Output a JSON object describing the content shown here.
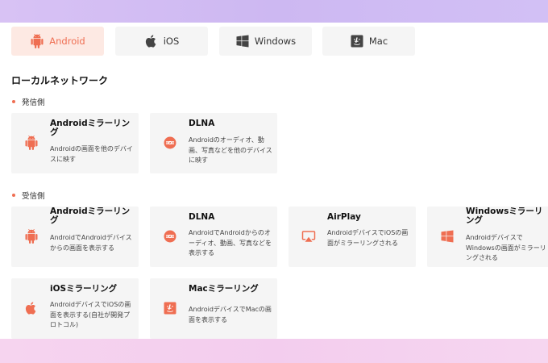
{
  "tabs": [
    {
      "label": "Android",
      "icon": "android-icon",
      "active": true
    },
    {
      "label": "iOS",
      "icon": "apple-icon",
      "active": false
    },
    {
      "label": "Windows",
      "icon": "windows-icon",
      "active": false
    },
    {
      "label": "Mac",
      "icon": "mac-icon",
      "active": false
    }
  ],
  "section_title": "ローカルネットワーク",
  "sender": {
    "label": "発信側",
    "cards": [
      {
        "title": "Androidミラーリング",
        "desc": "Androidの画面を他のデバイスに映す",
        "icon": "android-icon"
      },
      {
        "title": "DLNA",
        "desc": "Androidのオーディオ、動画、写真などを他のデバイスに映す",
        "icon": "dlna-icon"
      }
    ]
  },
  "receiver": {
    "label": "受信側",
    "cards": [
      {
        "title": "Androidミラーリング",
        "desc": "AndroidでAndroidデバイスからの画面を表示する",
        "icon": "android-icon"
      },
      {
        "title": "DLNA",
        "desc": "AndroidでAndroidからのオーディオ、動画、写真などを表示する",
        "icon": "dlna-icon"
      },
      {
        "title": "AirPlay",
        "desc": "AndroidデバイスでiOSの画面がミラーリングされる",
        "icon": "airplay-icon"
      },
      {
        "title": "Windowsミラーリング",
        "desc": "AndroidデバイスでWindowsの画面がミラーリングされる",
        "icon": "windows-icon"
      },
      {
        "title": "iOSミラーリング",
        "desc": "AndroidデバイスでiOSの画面を表示する(自社が開発プロトコル)",
        "icon": "apple-icon"
      },
      {
        "title": "Macミラーリング",
        "desc": "AndroidデバイスでMacの画面を表示する",
        "icon": "mac-icon"
      }
    ]
  },
  "colors": {
    "accent": "#ef6e52",
    "tab_active_bg": "#fde9e3",
    "card_bg": "#f5f5f5",
    "icon_gray": "#444444"
  }
}
